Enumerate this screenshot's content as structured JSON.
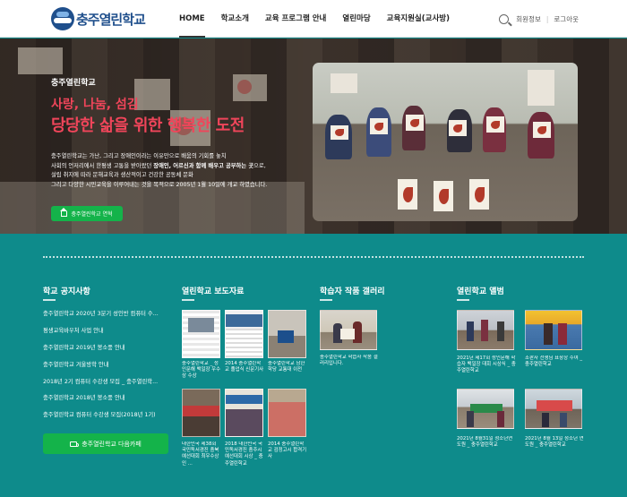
{
  "header": {
    "logo_text": "충주열린학교",
    "nav": [
      "HOME",
      "학교소개",
      "교육 프로그램 안내",
      "열린마당",
      "교육지원실(교사방)"
    ],
    "member_info": "회원정보",
    "logout": "로그아웃"
  },
  "hero": {
    "label": "충주열린학교",
    "title_line1": "사랑, 나눔, 섬김",
    "title_line2": "당당한 삶을 위한 행복한 도전",
    "desc_line1": "충주열린학교는 가난, 그리고 장애인이라는 이유만으로 배움의 기회를 놓치",
    "desc_line2_pre": "사회의 언저리에서 한평생 고통을 받아왔던 ",
    "desc_line2_bold": "장애인, 어르신과 함께 배우고 공부하는 곳",
    "desc_line2_post": "으로,",
    "desc_line3": "설립 취지에 따라 문해교육과 생산적이고 건강한 공동체 문화",
    "desc_line4": "그리고 다양한 시민교육을 이루어내는 것을 목적으로 2005년 1월 10일에 개교 하였습니다.",
    "button_label": "충주열린학교 연혁"
  },
  "sections": {
    "notice": {
      "title": "학교 공지사항",
      "items": [
        "충주열린학교 2020년 3분기 성인반 컴퓨터 수...",
        "평생교육바우처 사업 안내",
        "충주열린학교 2019년 봉소풍 안내",
        "충주열린학교 겨울방학 안내",
        "2018년 2기 컴퓨터 수강생 모집 _ 충주열린학...",
        "충주열린학교 2018년 봉소풍 안내",
        "충주열린학교 컴퓨터 수강생 모집(2018년 1기)"
      ],
      "cafe_button": "충주열린학교 다음카페"
    },
    "press": {
      "title": "열린학교 보도자료",
      "items": [
        "충주열린학교 _ 성인문해 백일장 우수상 수상",
        "2014 충주열린학교 졸업식 신문기사",
        "충주열린학교 남한학당 교통대 이전",
        "대한민국 제38회 국민독서경진 충북예선대회 최우수상 인 ...",
        "2018 대한민국 국민독서경진 충주시예선대회 시상 _ 충주열린학교",
        "2014 충주열린학교 검정고시 합격기사"
      ]
    },
    "gallery": {
      "title": "학습자 작품 갤러리",
      "caption": "충주열린학교 학습자 작품 갤러리입니다."
    },
    "album": {
      "title": "열린학교 앨범",
      "items": [
        "2021년 제17회 성인문해 학습자 백일장 대회 시상식 _ 충주열린학교",
        "조판자 선생님 표창장 수여 _ 충주열린학교",
        "2021년 8월31일 청소년연 도원 _ 충주열린학교",
        "2021년 8월 13일 청소년 연도원 _ 충주열린학교"
      ]
    }
  }
}
